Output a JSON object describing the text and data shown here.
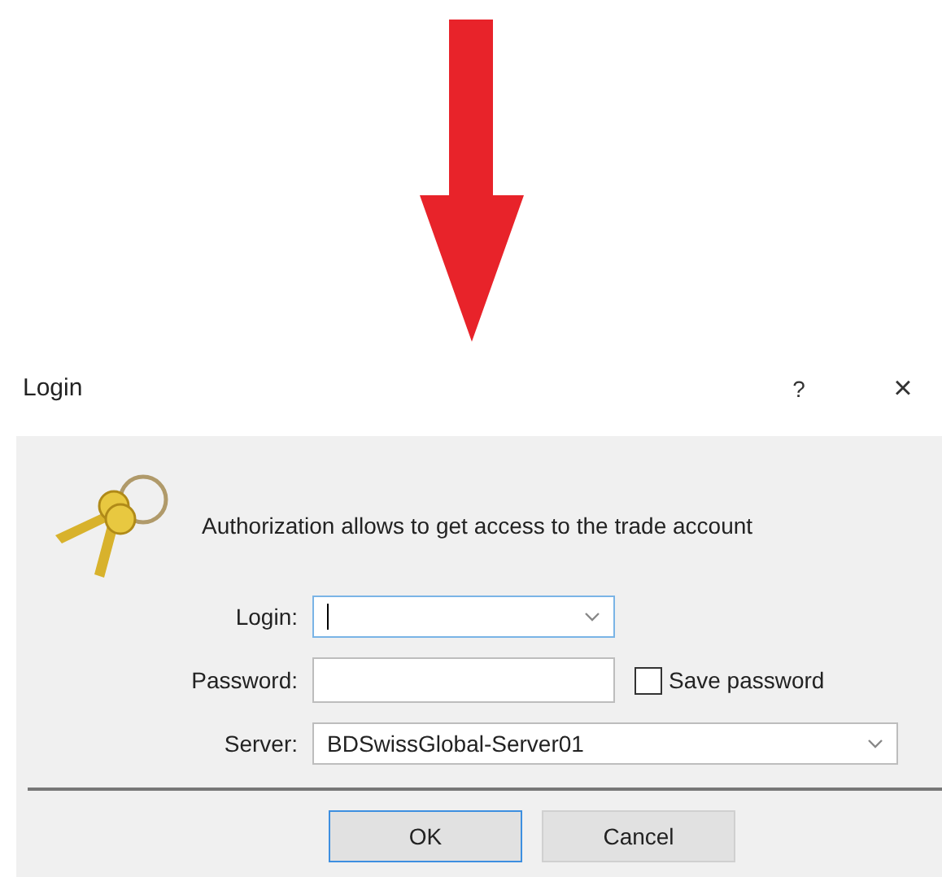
{
  "window": {
    "title": "Login",
    "help_glyph": "?",
    "close_glyph": "×"
  },
  "message": "Authorization allows to get access to the trade account",
  "fields": [
    {
      "kind": "combo",
      "label": "Login:",
      "focused": true
    },
    {
      "kind": "password",
      "label": "Password:",
      "focused": false,
      "checkbox": {
        "label": "Save password",
        "checked": false
      }
    },
    {
      "kind": "combo",
      "label": "Server:",
      "value": "BDSwissGlobal-Server01",
      "focused": false
    }
  ],
  "buttons": [
    {
      "label": "OK",
      "default": true
    },
    {
      "label": "Cancel",
      "default": false
    }
  ]
}
